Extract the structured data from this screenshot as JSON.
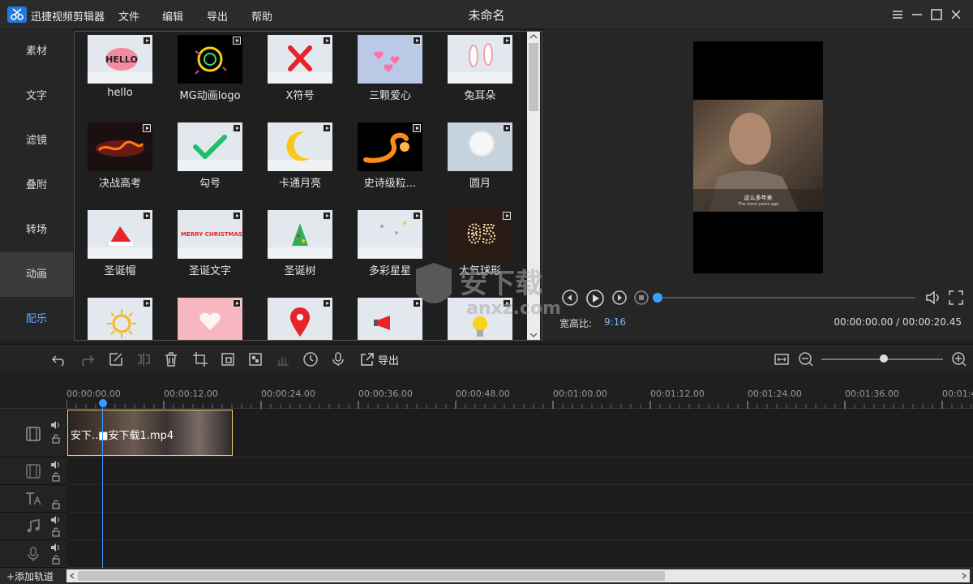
{
  "app": {
    "name": "迅捷视频剪辑器",
    "window_title": "未命名",
    "menu": [
      "文件",
      "编辑",
      "导出",
      "帮助"
    ]
  },
  "sidebar": {
    "items": [
      {
        "label": "素材",
        "active": false
      },
      {
        "label": "文字",
        "active": false
      },
      {
        "label": "滤镜",
        "active": false
      },
      {
        "label": "叠附",
        "active": false
      },
      {
        "label": "转场",
        "active": false
      },
      {
        "label": "动画",
        "active": true
      },
      {
        "label": "配乐",
        "active": false
      }
    ]
  },
  "library": {
    "rows": [
      [
        {
          "label": "hello",
          "icon": "hello-bubble-icon"
        },
        {
          "label": "MG动画logo",
          "icon": "mg-logo-icon"
        },
        {
          "label": "X符号",
          "icon": "x-mark-icon"
        },
        {
          "label": "三颗爱心",
          "icon": "three-hearts-icon"
        },
        {
          "label": "兔耳朵",
          "icon": "bunny-ears-icon"
        }
      ],
      [
        {
          "label": "决战高考",
          "icon": "fire-text-icon"
        },
        {
          "label": "勾号",
          "icon": "check-mark-icon"
        },
        {
          "label": "卡通月亮",
          "icon": "moon-icon"
        },
        {
          "label": "史诗级粒...",
          "icon": "fire-particle-icon"
        },
        {
          "label": "圆月",
          "icon": "full-moon-icon"
        }
      ],
      [
        {
          "label": "圣诞帽",
          "icon": "santa-hat-icon"
        },
        {
          "label": "圣诞文字",
          "icon": "merry-christmas-icon",
          "thumb_text": "MERRY CHRISTMAS"
        },
        {
          "label": "圣诞树",
          "icon": "christmas-tree-icon"
        },
        {
          "label": "多彩星星",
          "icon": "colorful-stars-icon"
        },
        {
          "label": "大气球形",
          "icon": "led-countdown-icon",
          "thumb_text": "05"
        }
      ],
      [
        {
          "label": "",
          "icon": "sun-icon"
        },
        {
          "label": "",
          "icon": "pink-heart-icon"
        },
        {
          "label": "",
          "icon": "location-pin-icon"
        },
        {
          "label": "",
          "icon": "megaphone-icon"
        },
        {
          "label": "",
          "icon": "lightbulb-icon"
        }
      ]
    ],
    "hello_text": "HELLO"
  },
  "preview": {
    "aspect_label": "宽高比:",
    "aspect_value": "9:16",
    "timecode": "00:00:00.00 / 00:00:20.45",
    "progress": 0,
    "subtitle_line1": "这么多年来",
    "subtitle_line2": "The more years ago"
  },
  "toolbar": {
    "export_label": "导出",
    "zoom_level": 0.5
  },
  "timeline": {
    "ticks": [
      "00:00:00.00",
      "00:00:12.00",
      "00:00:24.00",
      "00:00:36.00",
      "00:00:48.00",
      "00:01:00.00",
      "00:01:12.00",
      "00:01:24.00",
      "00:01:36.00",
      "00:01:4"
    ],
    "clip_name": "安下..■安下载1.mp4",
    "add_track": "+添加轨道"
  },
  "watermark": {
    "text": "安下载",
    "sub": "anxz.com"
  },
  "colors": {
    "accent": "#3a9bff",
    "clip_border": "#e8d86a",
    "active_blue": "#5aa8ff"
  }
}
